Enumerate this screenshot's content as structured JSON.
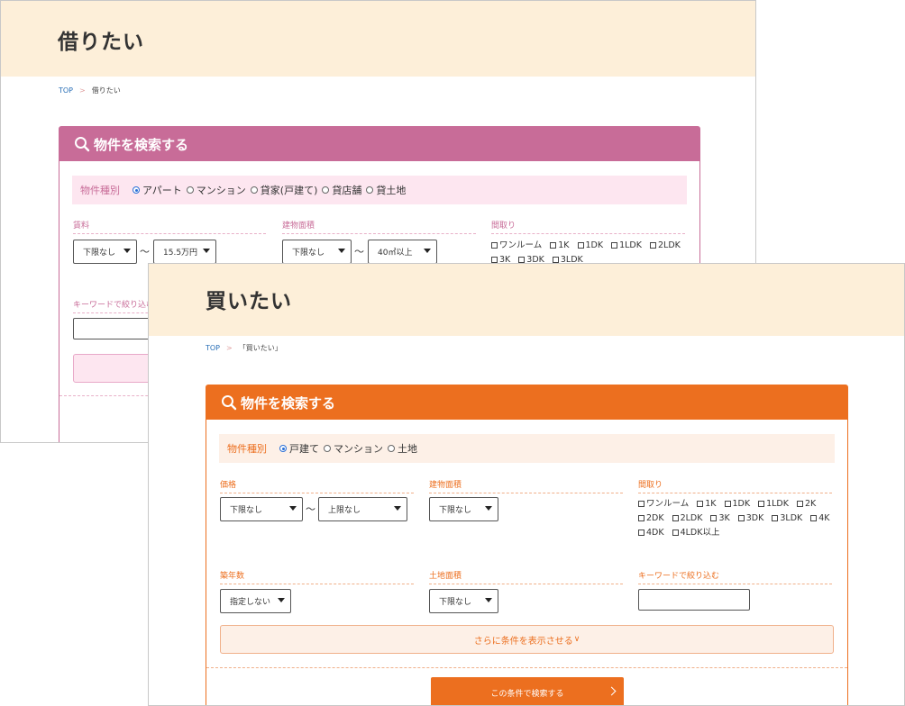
{
  "rent": {
    "title": "借りたい",
    "breadcrumb": {
      "top": "TOP",
      "sep": ">",
      "current": "借りたい"
    },
    "panel_title": "物件を検索する",
    "property_type": {
      "label": "物件種別",
      "options": [
        "アパート",
        "マンション",
        "貸家(戸建て)",
        "貸店舗",
        "貸土地"
      ],
      "selected_index": 0
    },
    "rent_label": "賃料",
    "rent_min": "下限なし",
    "rent_max": "15.5万円",
    "range_sep": "〜",
    "area_label": "建物面積",
    "area_min": "下限なし",
    "area_max": "40㎡以上",
    "layout_label": "間取り",
    "layouts": [
      "ワンルーム",
      "1K",
      "1DK",
      "1LDK",
      "2LDK",
      "3K",
      "3DK",
      "3LDK"
    ],
    "keyword_label": "キーワードで絞り込む"
  },
  "buy": {
    "title": "買いたい",
    "breadcrumb": {
      "top": "TOP",
      "sep": ">",
      "current": "「買いたい」"
    },
    "panel_title": "物件を検索する",
    "property_type": {
      "label": "物件種別",
      "options": [
        "戸建て",
        "マンション",
        "土地"
      ],
      "selected_index": 0
    },
    "price_label": "価格",
    "price_min": "下限なし",
    "price_max": "上限なし",
    "range_sep": "〜",
    "area_label": "建物面積",
    "area_min": "下限なし",
    "layout_label": "間取り",
    "layouts": [
      "ワンルーム",
      "1K",
      "1DK",
      "1LDK",
      "2K",
      "2DK",
      "2LDK",
      "3K",
      "3DK",
      "3LDK",
      "4K",
      "4DK",
      "4LDK以上"
    ],
    "age_label": "築年数",
    "age_value": "指定しない",
    "land_label": "土地面積",
    "land_min": "下限なし",
    "keyword_label": "キーワードで絞り込む",
    "more_label": "さらに条件を表示させる",
    "more_chevron": "∨",
    "submit_label": "この条件で検索する"
  },
  "colors": {
    "rent_accent": "#c86c98",
    "buy_accent": "#ec6f1f",
    "header_bg": "#fdefd9"
  }
}
